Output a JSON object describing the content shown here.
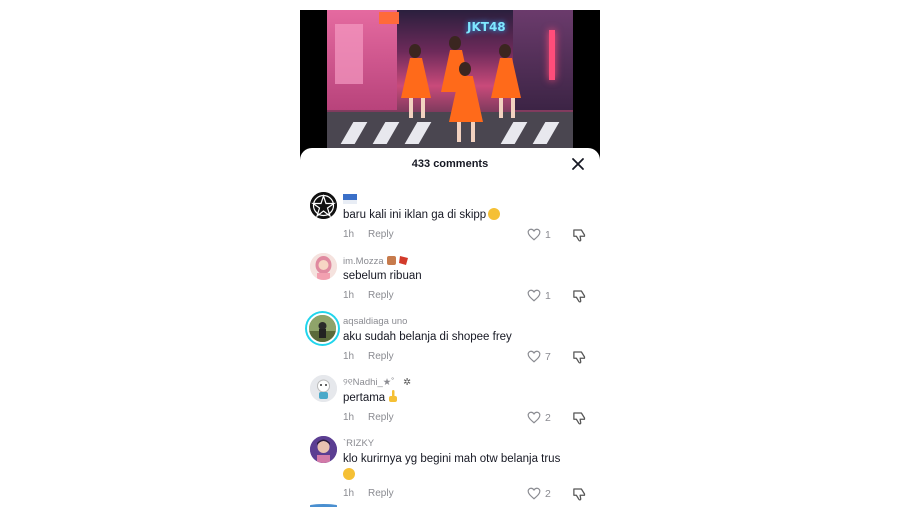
{
  "video": {
    "logo_text": "JKT48"
  },
  "comments_panel": {
    "count_label": "433 comments",
    "close_icon": "close-icon"
  },
  "comments": [
    {
      "username": "",
      "username_badge": "flag-badge-icon",
      "text": "baru kali ini iklan ga di skipp",
      "text_emoji": "grinning-face-emoji",
      "time": "1h",
      "reply_label": "Reply",
      "likes": "1",
      "avatar": "star-pentagram-avatar"
    },
    {
      "username": "im.Mozza",
      "username_badge": "decorative-emoji-icons",
      "text": "sebelum ribuan",
      "time": "1h",
      "reply_label": "Reply",
      "likes": "1",
      "avatar": "pink-hair-girl-avatar"
    },
    {
      "username": "aqsaldiaga uno",
      "text": "aku sudah belanja di shopee frey",
      "time": "1h",
      "reply_label": "Reply",
      "likes": "7",
      "avatar": "outdoor-person-avatar",
      "avatar_ring_color": "#20d5ec"
    },
    {
      "username": "୨୧Nadhi_★˚",
      "username_suffix": "✲",
      "text": "pertama",
      "text_emoji": "pointing-up-emoji",
      "time": "1h",
      "reply_label": "Reply",
      "likes": "2",
      "avatar": "cartoon-figure-avatar"
    },
    {
      "username": "`RIZKY",
      "text": "klo kurirnya yg begini mah otw belanja trus",
      "text_emoji": "grinning-face-emoji",
      "time": "1h",
      "reply_label": "Reply",
      "likes": "2",
      "avatar": "purple-portrait-avatar"
    }
  ],
  "colors": {
    "text_primary": "#161823",
    "text_secondary": "#8a8b91",
    "avatar_ring": "#20d5ec"
  }
}
